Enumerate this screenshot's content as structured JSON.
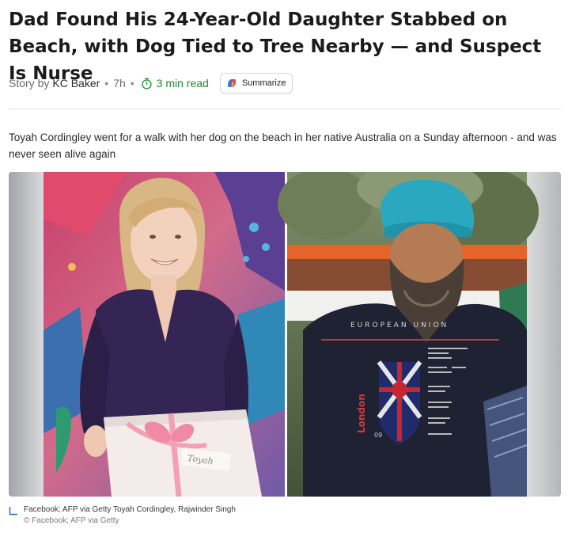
{
  "article": {
    "headline": "Dad Found His 24-Year-Old Daughter Stabbed on Beach, with Dog Tied to Tree Nearby — and Suspect Is Nurse",
    "byline": {
      "prefix": "Story by",
      "author": "KC Baker",
      "separator": "•",
      "age": "7h",
      "read_time": "3 min read",
      "summarize_label": "Summarize"
    },
    "summary": "Toyah Cordingley went for a walk with her dog on the beach in her native Australia on a Sunday afternoon - and was never seen alive again",
    "image": {
      "left_photo": "woman smiling holding a gift box with pink ribbon",
      "right_photo": "bearded man in turquoise turban wearing dark sweatshirt",
      "gift_tag_text": "Toyah",
      "sweatshirt_text": "EUROPEAN UNION",
      "sweatshirt_side_text": "London",
      "sweatshirt_number": "09"
    },
    "caption": "Facebook; AFP via Getty Toyah Cordingley, Rajwinder Singh",
    "credit": "© Facebook; AFP via Getty"
  },
  "colors": {
    "accent_green": "#1f8a2e",
    "turban": "#2aa8c0",
    "ribbon": "#f2a0b4",
    "bus_orange": "#e4642a"
  },
  "icons": [
    "clock-icon",
    "copilot-icon",
    "caption-corner-icon"
  ]
}
